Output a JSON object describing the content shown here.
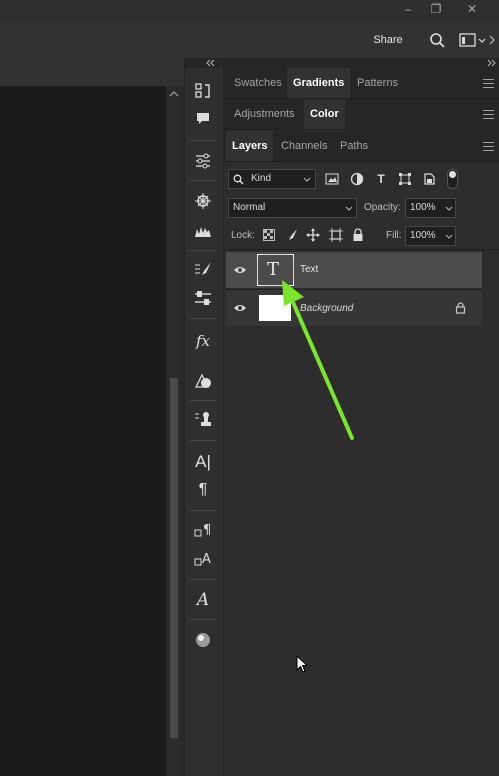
{
  "window": {
    "minimize_glyph": "–",
    "restore_glyph": "❐",
    "close_glyph": "✕"
  },
  "options_bar": {
    "share_label": "Share"
  },
  "panel_groups": [
    {
      "tabs": [
        "Swatches",
        "Gradients",
        "Patterns"
      ],
      "active": "Gradients"
    },
    {
      "tabs": [
        "Adjustments",
        "Color"
      ],
      "active": "Color"
    },
    {
      "tabs": [
        "Layers",
        "Channels",
        "Paths"
      ],
      "active": "Layers"
    }
  ],
  "layers_panel": {
    "filter_kind": "Kind",
    "blend_mode": "Normal",
    "opacity_label": "Opacity:",
    "opacity_value": "100%",
    "lock_label": "Lock:",
    "fill_label": "Fill:",
    "fill_value": "100%",
    "layers": [
      {
        "name": "Text",
        "type": "text",
        "thumb_glyph": "T",
        "selected": true,
        "visible": true,
        "locked": false
      },
      {
        "name": "Background",
        "type": "pixel",
        "selected": false,
        "visible": true,
        "locked": true
      }
    ]
  },
  "tool_strip": {
    "icons": [
      "history-icon",
      "comments-icon",
      "adjustments-icon",
      "navigator-icon",
      "histogram-icon",
      "brush-settings-icon",
      "properties-icon",
      "styles-icon",
      "shapes-icon",
      "clone-source-icon",
      "character-icon",
      "paragraph-icon",
      "paragraph-styles-icon",
      "character-styles-icon",
      "glyphs-icon",
      "materials-icon"
    ]
  },
  "colors": {
    "annotation_arrow": "#7be52b",
    "panel_bg": "#2d2d2d",
    "selected_row": "#4b4b4b"
  }
}
